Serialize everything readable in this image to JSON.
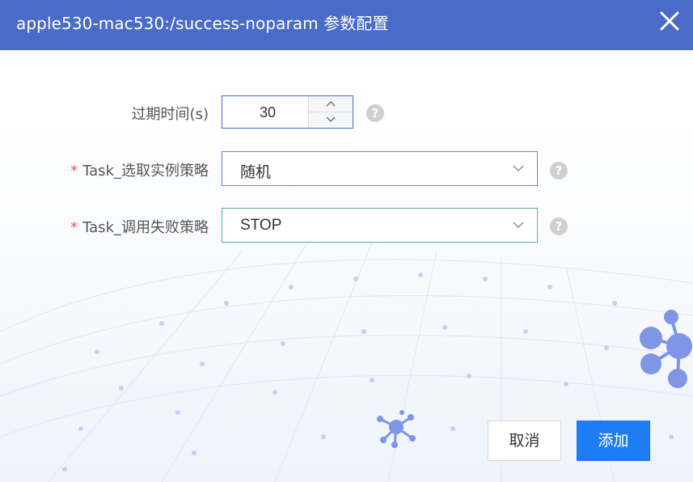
{
  "dialog": {
    "title": "apple530-mac530:/success-noparam 参数配置",
    "close_icon": "close-icon"
  },
  "form": {
    "expire": {
      "label": "过期时间(s)",
      "value": "30",
      "help": "?"
    },
    "route_strategy": {
      "required_mark": "*",
      "label": "Task_选取实例策略",
      "value": "随机",
      "help": "?"
    },
    "fail_strategy": {
      "required_mark": "*",
      "label": "Task_调用失败策略",
      "value": "STOP",
      "help": "?"
    }
  },
  "buttons": {
    "cancel": "取消",
    "add": "添加"
  },
  "colors": {
    "titlebar": "#4a6bc8",
    "primary": "#1e7cf5",
    "required": "#e4585a"
  }
}
